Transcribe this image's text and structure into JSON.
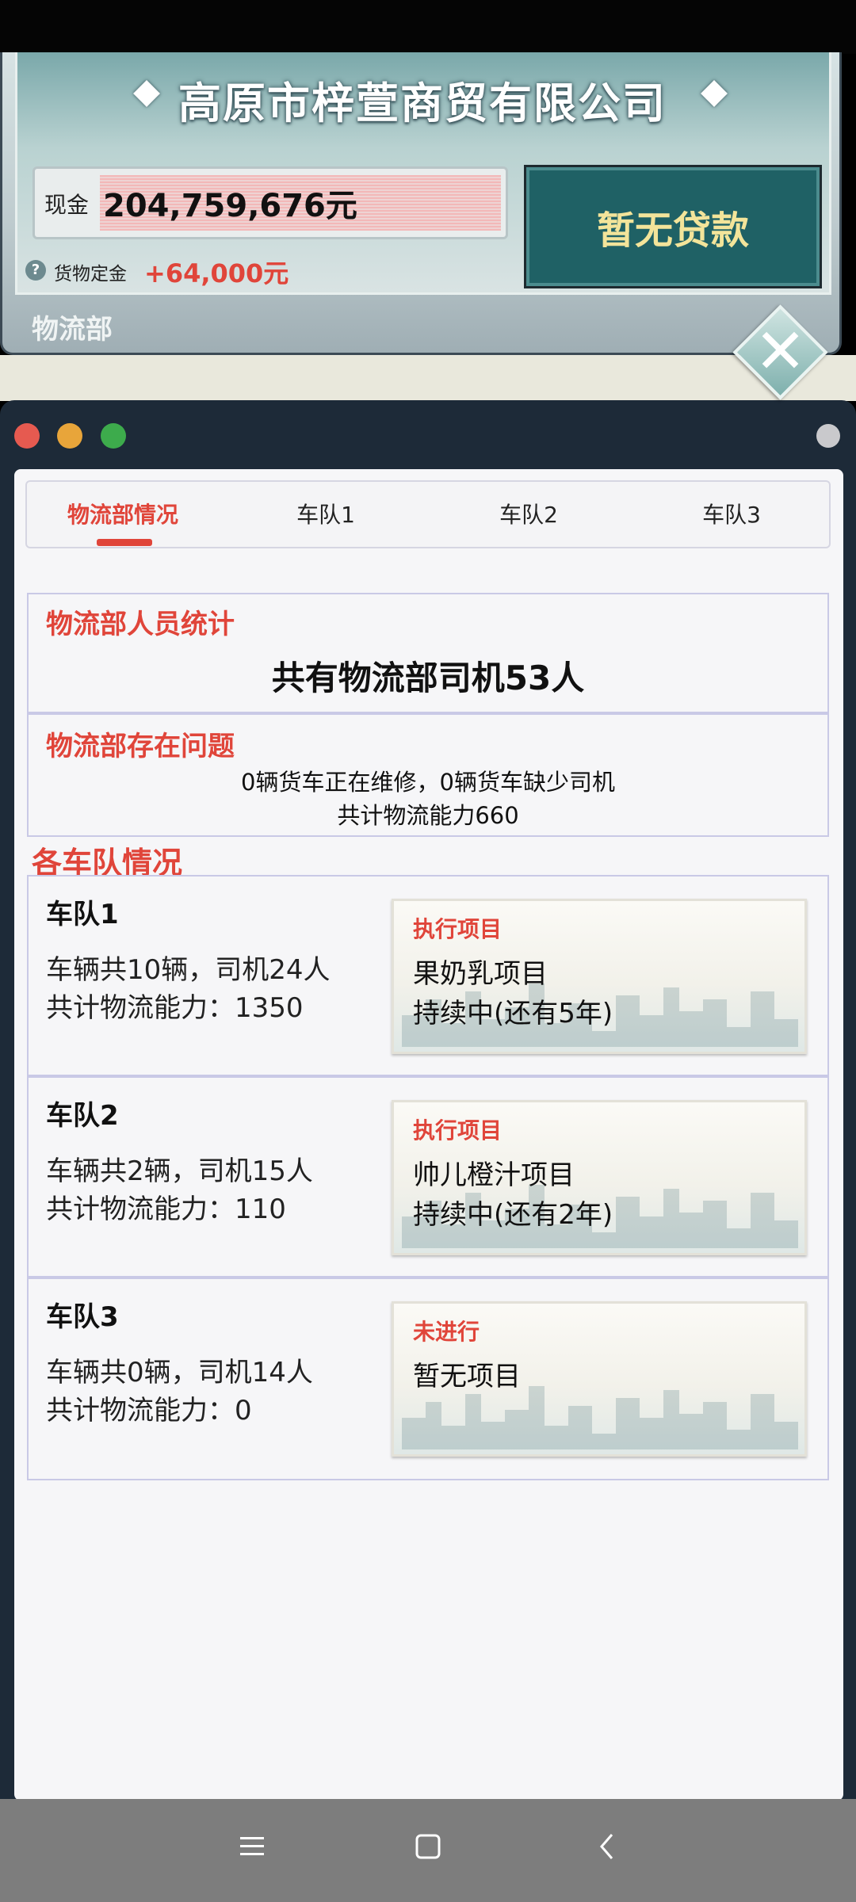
{
  "header": {
    "company_name": "高原市梓萱商贸有限公司",
    "cash_label": "现金",
    "cash_value": "204,759,676元",
    "deposit_label": "货物定金",
    "deposit_value": "+64,000元",
    "help_icon": "?",
    "loan_button": "暂无贷款",
    "department": "物流部"
  },
  "tabs": [
    {
      "label": "物流部情况",
      "active": true
    },
    {
      "label": "车队1"
    },
    {
      "label": "车队2"
    },
    {
      "label": "车队3"
    }
  ],
  "staff": {
    "title": "物流部人员统计",
    "summary": "共有物流部司机53人"
  },
  "issues": {
    "title": "物流部存在问题",
    "line1": "0辆货车正在维修，0辆货车缺少司机",
    "line2": "共计物流能力660"
  },
  "teams_section_title": "各车队情况",
  "teams": [
    {
      "name": "车队1",
      "line1": "车辆共10辆，司机24人",
      "line2": "共计物流能力：1350",
      "status": "执行项目",
      "project": "果奶乳项目",
      "progress": "持续中(还有5年)"
    },
    {
      "name": "车队2",
      "line1": "车辆共2辆，司机15人",
      "line2": "共计物流能力：110",
      "status": "执行项目",
      "project": "帅儿橙汁项目",
      "progress": "持续中(还有2年)"
    },
    {
      "name": "车队3",
      "line1": "车辆共0辆，司机14人",
      "line2": "共计物流能力：0",
      "status": "未进行",
      "project": "暂无项目",
      "progress": ""
    }
  ],
  "colors": {
    "accent_red": "#e0453a",
    "loan_button_bg": "#1f6165",
    "loan_button_text": "#f3e49a",
    "window_dark": "#1d2a38"
  },
  "icons": {
    "close": "close-icon",
    "nav_menu": "menu-icon",
    "nav_home": "home-icon",
    "nav_back": "back-icon"
  }
}
